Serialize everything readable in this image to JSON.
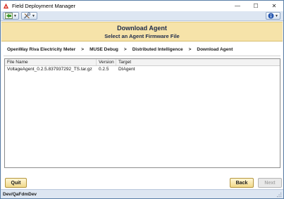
{
  "window": {
    "title": "Field Deployment Manager",
    "minimize": "—",
    "maximize": "☐",
    "close": "✕"
  },
  "header": {
    "title": "Download Agent",
    "subtitle": "Select an Agent Firmware File"
  },
  "breadcrumb": [
    "OpenWay Riva Electricity Meter",
    ">",
    "MUSE Debug",
    ">",
    "Distributed Intelligence",
    ">",
    "Download Agent"
  ],
  "table": {
    "columns": [
      "File Name",
      "Version",
      "Target"
    ],
    "rows": [
      [
        "VoltageAgent_0.2.5.837937292_TS.tar.gz",
        "0.2.5",
        "DIAgent"
      ]
    ]
  },
  "buttons": {
    "quit": "Quit",
    "back": "Back",
    "next": "Next"
  },
  "status": {
    "text": "Dev/QaFdmDev"
  },
  "colors": {
    "header_bg": "#f6e3a9",
    "button_bg": "#f1d98a",
    "toolbar_bg": "#dde6f2",
    "app_icon": "#d62b1f"
  }
}
